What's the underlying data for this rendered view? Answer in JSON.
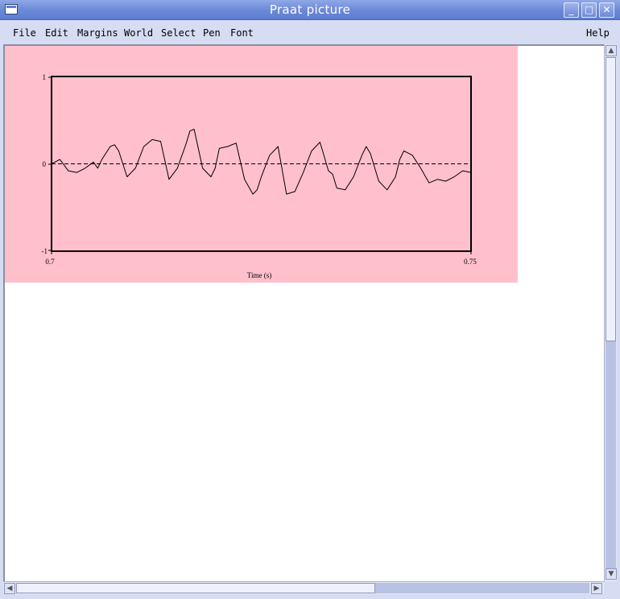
{
  "window": {
    "title": "Praat picture",
    "menu_icon": "window-menu-icon",
    "controls": {
      "minimize": "minimize-icon",
      "maximize": "maximize-icon",
      "close": "close-icon"
    }
  },
  "menu": {
    "file": "File",
    "edit": "Edit",
    "margins": "Margins",
    "world": "World",
    "select": "Select",
    "pen": "Pen",
    "font": "Font",
    "help": "Help"
  },
  "colors": {
    "selection": "#ffc0cb",
    "titlebar": "#6d8ad8",
    "menubar": "#d6dcf2"
  },
  "chart_data": {
    "type": "line",
    "title": "",
    "xlabel": "Time (s)",
    "ylabel": "",
    "xlim": [
      0.7,
      0.75
    ],
    "ylim": [
      -1,
      1
    ],
    "x_tick_labels": [
      "0.7",
      "0.75"
    ],
    "y_tick_labels": [
      "1",
      "0",
      "-1"
    ],
    "zero_line": "dashed",
    "grid": false,
    "series": [
      {
        "x": [
          0.7,
          0.701,
          0.702,
          0.703,
          0.704,
          0.705,
          0.7055,
          0.706,
          0.707,
          0.7075,
          0.708,
          0.709,
          0.71,
          0.711,
          0.712,
          0.713,
          0.714,
          0.715,
          0.716,
          0.7165,
          0.717,
          0.718,
          0.719,
          0.7195,
          0.72,
          0.721,
          0.722,
          0.723,
          0.724,
          0.7245,
          0.725,
          0.726,
          0.727,
          0.728,
          0.729,
          0.73,
          0.731,
          0.732,
          0.733,
          0.7335,
          0.734,
          0.735,
          0.736,
          0.737,
          0.7375,
          0.738,
          0.739,
          0.74,
          0.741,
          0.7415,
          0.742,
          0.743,
          0.744,
          0.745,
          0.746,
          0.747,
          0.748,
          0.749,
          0.75
        ],
        "y": [
          0.0,
          0.05,
          -0.08,
          -0.1,
          -0.05,
          0.02,
          -0.05,
          0.05,
          0.2,
          0.22,
          0.15,
          -0.15,
          -0.05,
          0.2,
          0.28,
          0.26,
          -0.18,
          -0.05,
          0.22,
          0.38,
          0.4,
          -0.05,
          -0.15,
          -0.05,
          0.18,
          0.2,
          0.24,
          -0.18,
          -0.35,
          -0.3,
          -0.15,
          0.1,
          0.2,
          -0.35,
          -0.32,
          -0.1,
          0.15,
          0.25,
          -0.08,
          -0.12,
          -0.28,
          -0.3,
          -0.15,
          0.1,
          0.2,
          0.12,
          -0.2,
          -0.3,
          -0.15,
          0.05,
          0.15,
          0.1,
          -0.05,
          -0.22,
          -0.18,
          -0.2,
          -0.15,
          -0.08,
          -0.1
        ]
      }
    ]
  }
}
